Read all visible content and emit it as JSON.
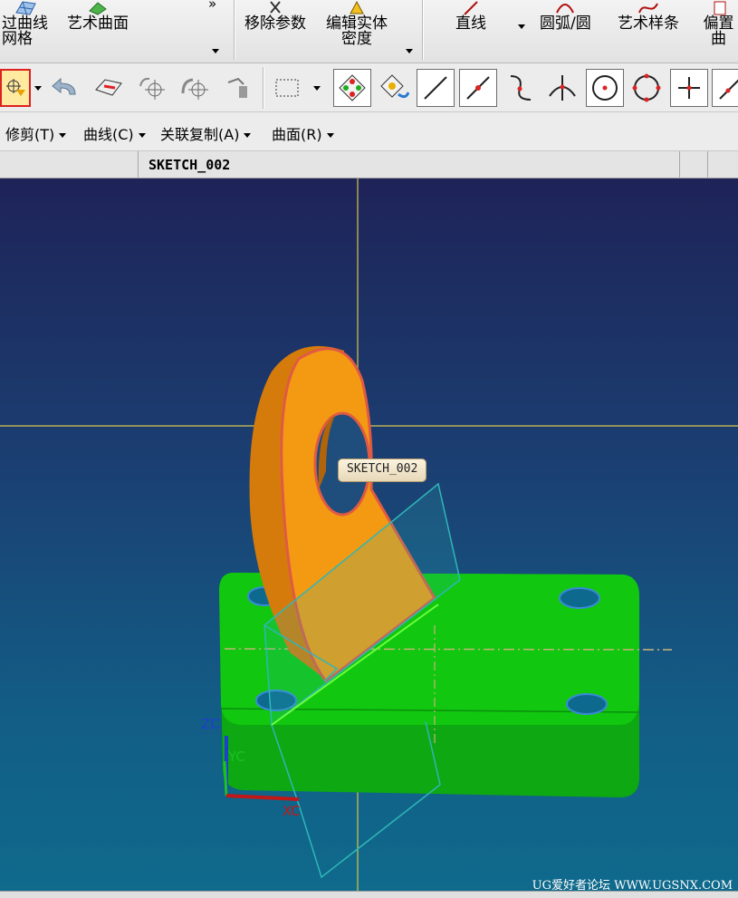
{
  "ribbon": {
    "groups": [
      {
        "label": "过曲线\n网格"
      },
      {
        "label": "艺术曲面"
      },
      {
        "label": "移除参数"
      },
      {
        "label": "编辑实体\n密度"
      },
      {
        "label": "直线"
      },
      {
        "label": "圆弧/圆"
      },
      {
        "label": "艺术样条"
      },
      {
        "label": "偏置曲"
      }
    ],
    "more_symbol": "»"
  },
  "menubar": {
    "items": [
      {
        "label": "修剪(T)"
      },
      {
        "label": "曲线(C)"
      },
      {
        "label": "关联复制(A)"
      },
      {
        "label": "曲面(R)"
      }
    ]
  },
  "tabbar": {
    "title": "SKETCH_002"
  },
  "viewport": {
    "tooltip": "SKETCH_002",
    "axis_labels": {
      "z": "ZC",
      "y": "YC",
      "x": "XC"
    },
    "colors": {
      "base": "#11c70f",
      "lug": "#f39a12",
      "edge": "#e05a43",
      "plane": "#2fb6b8",
      "crosshair": "#d7c64c"
    }
  },
  "watermark": "UG爱好者论坛 WWW.UGSNX.COM"
}
